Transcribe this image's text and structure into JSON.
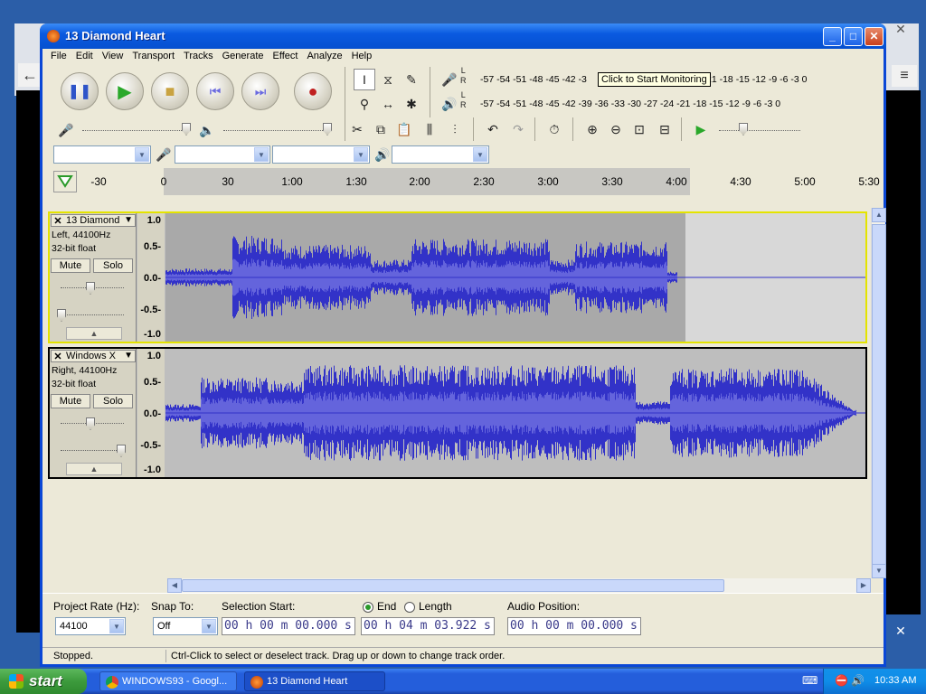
{
  "window": {
    "title": "13 Diamond Heart"
  },
  "menu": [
    "File",
    "Edit",
    "View",
    "Transport",
    "Tracks",
    "Generate",
    "Effect",
    "Analyze",
    "Help"
  ],
  "meters": {
    "record_scale": "-57 -54 -51 -48 -45 -42 -3",
    "record_scale_right": "21 -18 -15 -12  -9  -6  -3  0",
    "play_scale": "-57 -54 -51 -48 -45 -42 -39 -36 -33 -30 -27 -24 -21 -18 -15 -12  -9  -6  -3  0",
    "tooltip": "Click to Start Monitoring",
    "l": "L",
    "r": "R"
  },
  "timeline": {
    "ticks": [
      "-30",
      "0",
      "30",
      "1:00",
      "1:30",
      "2:00",
      "2:30",
      "3:00",
      "3:30",
      "4:00",
      "4:30",
      "5:00",
      "5:30"
    ]
  },
  "tracks": [
    {
      "name": "13 Diamond",
      "info1": "Left, 44100Hz",
      "info2": "32-bit float",
      "mute": "Mute",
      "solo": "Solo",
      "ruler": [
        "1.0",
        "0.5-",
        "0.0-",
        "-0.5-",
        "-1.0"
      ]
    },
    {
      "name": "Windows X",
      "info1": "Right, 44100Hz",
      "info2": "32-bit float",
      "mute": "Mute",
      "solo": "Solo",
      "ruler": [
        "1.0",
        "0.5-",
        "0.0-",
        "-0.5-",
        "-1.0"
      ]
    }
  ],
  "selection_bar": {
    "project_rate_label": "Project Rate (Hz):",
    "project_rate": "44100",
    "snap_label": "Snap To:",
    "snap_value": "Off",
    "sel_start_label": "Selection Start:",
    "sel_start": "00 h 00 m 00.000 s",
    "end_label": "End",
    "length_label": "Length",
    "end_value": "00 h 04 m 03.922 s",
    "audio_pos_label": "Audio Position:",
    "audio_pos": "00 h 00 m 00.000 s"
  },
  "status": {
    "state": "Stopped.",
    "hint": "Ctrl-Click to select or deselect track. Drag up or down to change track order."
  },
  "taskbar": {
    "start": "start",
    "task1": "WINDOWS93 - Googl...",
    "task2": "13 Diamond Heart",
    "clock": "10:33 AM"
  },
  "colors": {
    "wave": "#3232c8",
    "wave_rms": "#6464dc",
    "selection_border": "#e4e400"
  },
  "icons": [
    "pause-icon",
    "play-icon",
    "stop-icon",
    "skip-start-icon",
    "skip-end-icon",
    "record-icon"
  ]
}
